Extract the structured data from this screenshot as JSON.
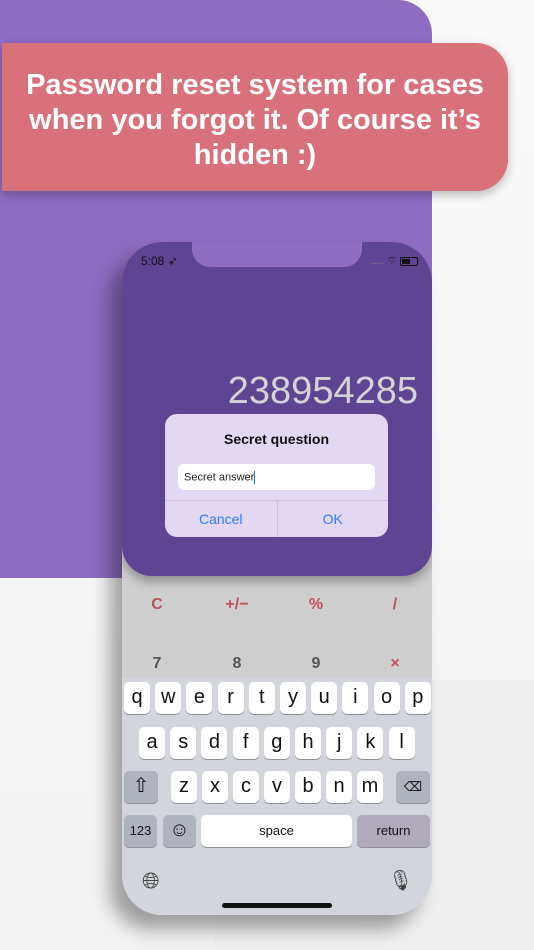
{
  "banner": {
    "text": "Password reset system for cases when you forgot it. Of course it’s hidden :)"
  },
  "status": {
    "time": "5:08",
    "signal": "....",
    "location_icon": "location-arrow-icon",
    "wifi_icon": "wifi-icon",
    "battery_icon": "battery-icon",
    "battery_level": 0.6
  },
  "calculator": {
    "display": "238954285",
    "row1": [
      "C",
      "+/−",
      "%",
      "/"
    ],
    "row2": [
      "7",
      "8",
      "9",
      "×"
    ]
  },
  "alert": {
    "title": "Secret question",
    "input_value": "Secret answer",
    "cancel": "Cancel",
    "ok": "OK"
  },
  "keyboard": {
    "row1": [
      "q",
      "w",
      "e",
      "r",
      "t",
      "y",
      "u",
      "i",
      "o",
      "p"
    ],
    "row2": [
      "a",
      "s",
      "d",
      "f",
      "g",
      "h",
      "j",
      "k",
      "l"
    ],
    "row3": [
      "z",
      "x",
      "c",
      "v",
      "b",
      "n",
      "m"
    ],
    "numbers": "123",
    "space": "space",
    "return": "return"
  },
  "colors": {
    "purple": "#8d6cc2",
    "screen": "#5e4594",
    "banner": "#d9717b",
    "accent": "#2f7cf6",
    "operator": "#c0505a"
  }
}
